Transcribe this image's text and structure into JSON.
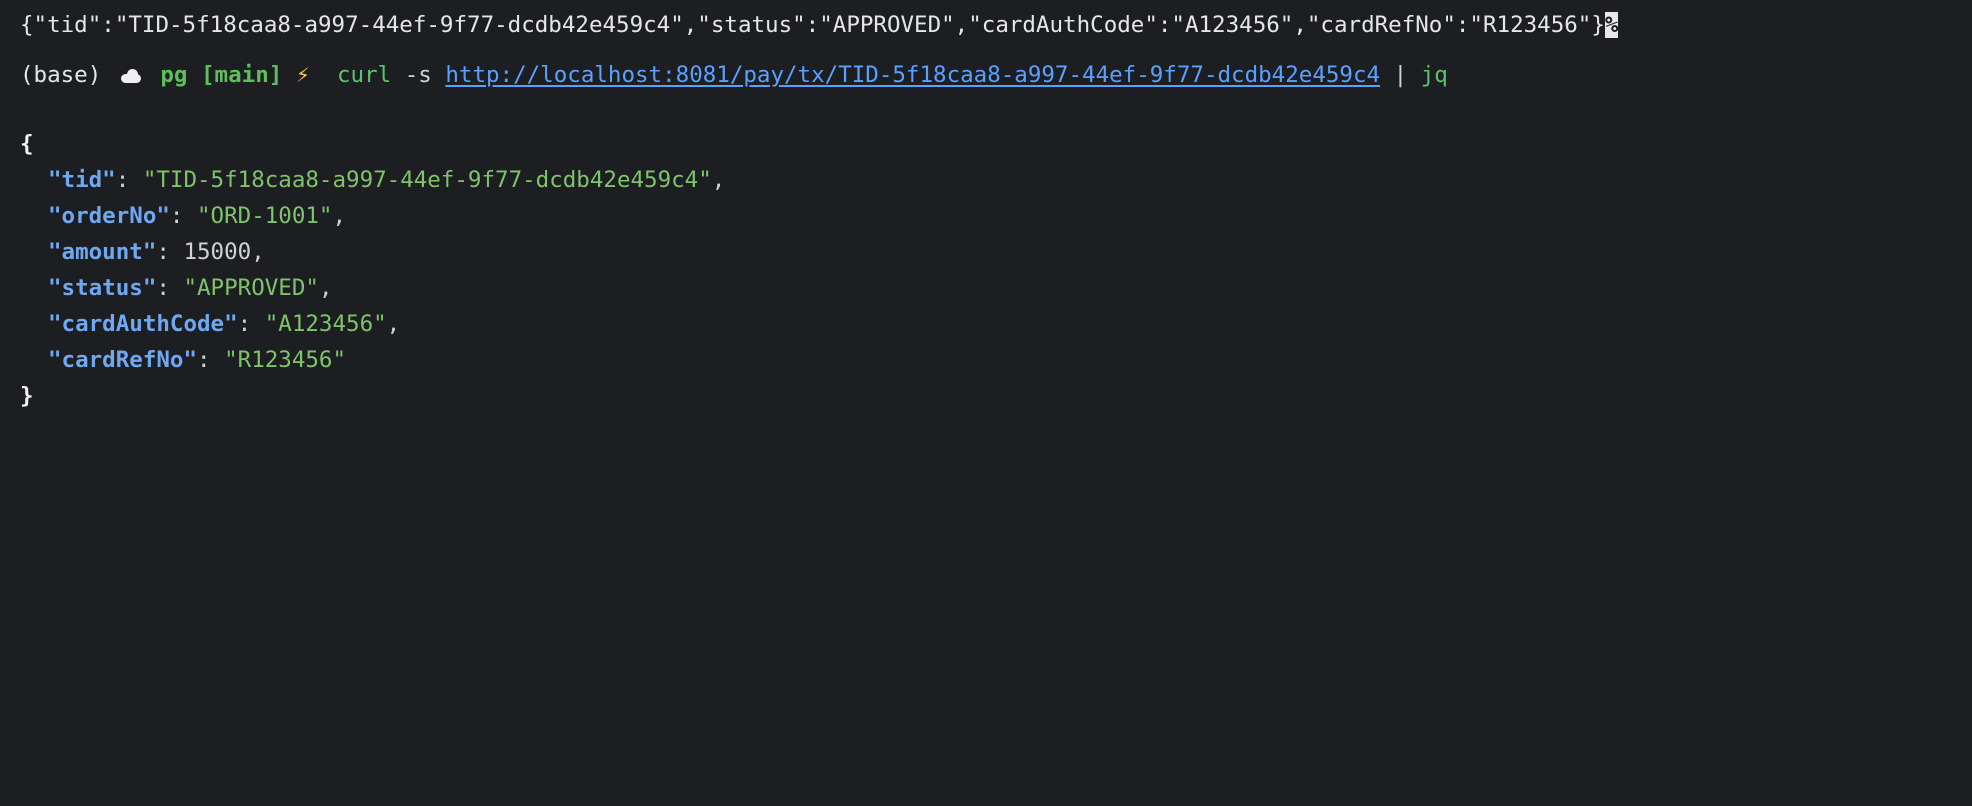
{
  "terminal": {
    "line1_raw": "{\"tid\":\"TID-5f18caa8-a997-44ef-9f77-dcdb42e459c4\",\"status\":\"APPROVED\",\"cardAuthCode\":\"A123456\",\"cardRefNo\":\"R123456\"}",
    "line1_eol_marker": "%",
    "prompt": {
      "env": "(base)",
      "dir": "pg",
      "branch": "[main]",
      "command": "curl",
      "flag": "-s",
      "url": "http://localhost:8081/pay/tx/TID-5f18caa8-a997-44ef-9f77-dcdb42e459c4",
      "pipe": "|",
      "pipe_cmd": "jq"
    },
    "json_open": "{",
    "json_close": "}",
    "json_fields": [
      {
        "key": "\"tid\"",
        "value": "\"TID-5f18caa8-a997-44ef-9f77-dcdb42e459c4\"",
        "trail": ","
      },
      {
        "key": "\"orderNo\"",
        "value": "\"ORD-1001\"",
        "trail": ","
      },
      {
        "key": "\"amount\"",
        "value": "15000",
        "trail": ","
      },
      {
        "key": "\"status\"",
        "value": "\"APPROVED\"",
        "trail": ","
      },
      {
        "key": "\"cardAuthCode\"",
        "value": "\"A123456\"",
        "trail": ","
      },
      {
        "key": "\"cardRefNo\"",
        "value": "\"R123456\"",
        "trail": ""
      }
    ]
  },
  "colors": {
    "background": "#1d1e22",
    "json_key": "#6fa8f2",
    "json_string": "#7ec46a",
    "url": "#5aa0ff",
    "prompt_green": "#5bc05a",
    "bolt": "#f2c94c"
  },
  "icons": {
    "prompt_cloud": "cloud-icon",
    "prompt_bolt": "bolt-icon"
  }
}
